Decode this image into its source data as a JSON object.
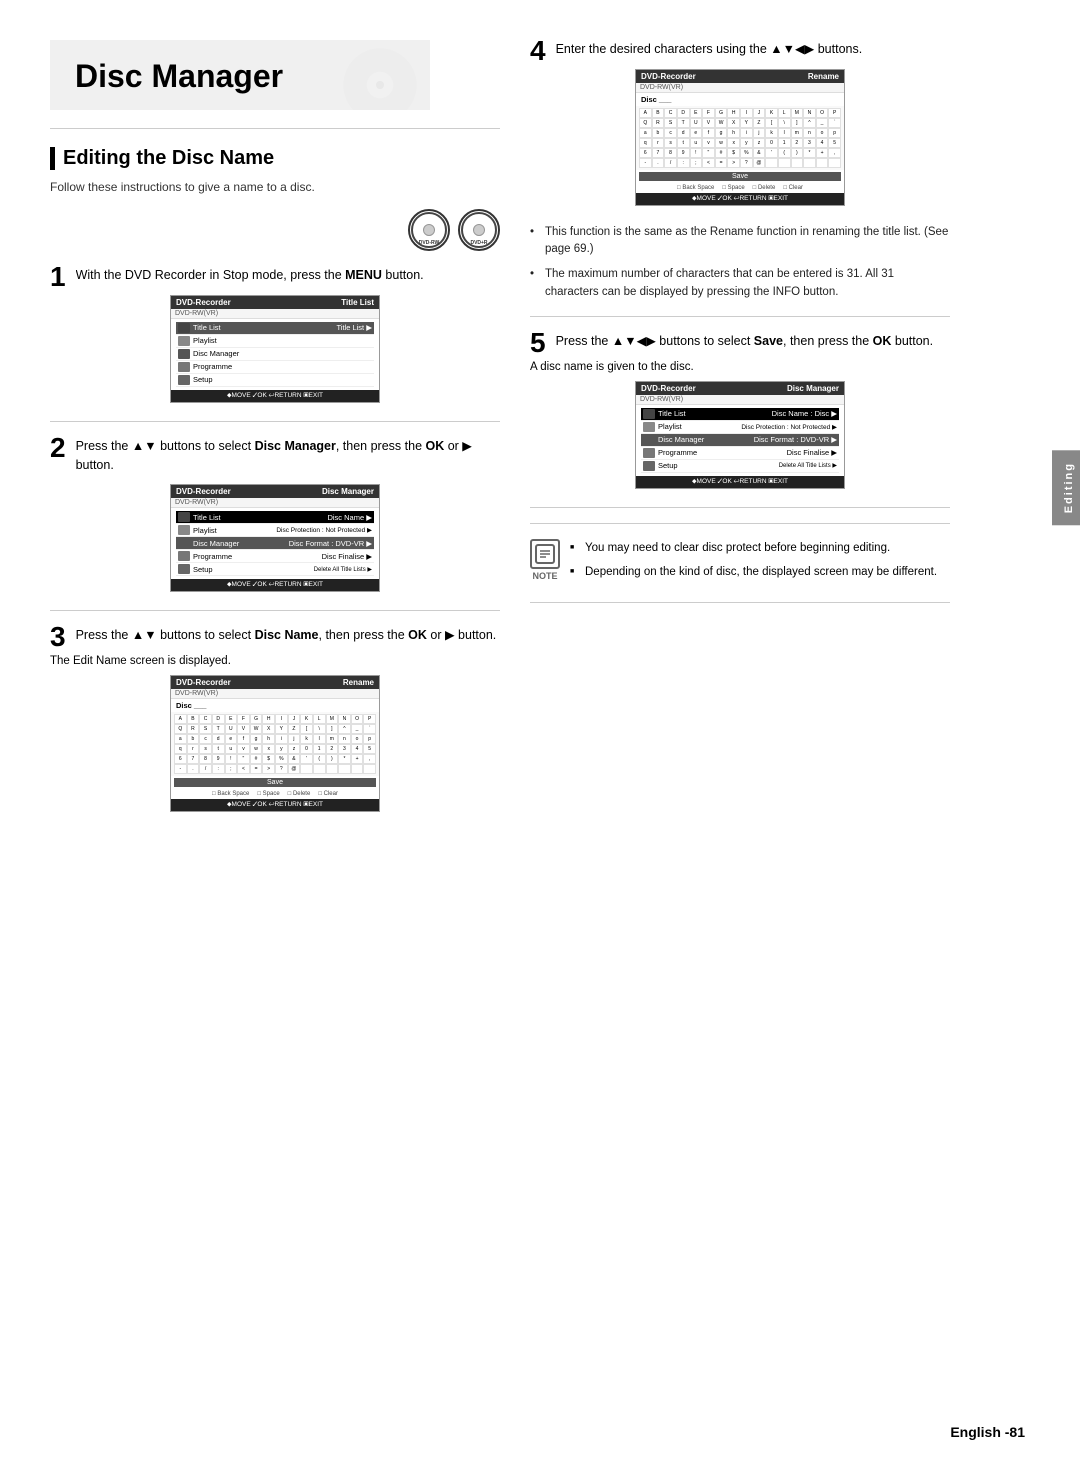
{
  "header": {
    "title": "Disc Manager",
    "section_title": "Editing the Disc Name",
    "follow_text": "Follow these instructions to give a name to a disc."
  },
  "dvd_icons": [
    {
      "label": "DVD-RW"
    },
    {
      "label": "DVD+R"
    }
  ],
  "steps": {
    "step1": {
      "number": "1",
      "text_main": "With the DVD Recorder in Stop mode, press the ",
      "text_bold": "MENU",
      "text_end": " button."
    },
    "step2": {
      "number": "2",
      "text_before": "Press the ▲▼ buttons to select ",
      "text_bold": "Disc Manager",
      "text_after": ", then press the ",
      "text_bold2": "OK",
      "text_end": " or ▶ button."
    },
    "step3": {
      "number": "3",
      "text_before": "Press the ▲▼ buttons to select ",
      "text_bold": "Disc Name",
      "text_after": ", then press the ",
      "text_bold2": "OK",
      "text_end": " or ▶ button.",
      "subtext": "The Edit Name screen is displayed."
    },
    "step4": {
      "number": "4",
      "text": "Enter the desired characters using the ▲▼◀▶ buttons."
    },
    "step5": {
      "number": "5",
      "text_before": "Press the ▲▼◀▶ buttons to select ",
      "text_bold": "Save",
      "text_after": ", then press the ",
      "text_bold2": "OK",
      "text_end": " button.",
      "subtext": "A disc name is given to the disc."
    }
  },
  "screen1": {
    "header_left": "DVD-Recorder",
    "header_right": "Title List",
    "dvd_label": "DVD-RW(VR)",
    "rows": [
      {
        "icon": "title-list",
        "label": "Title List",
        "value": "Title List",
        "active": true
      },
      {
        "icon": "playlist",
        "label": "Playlist",
        "value": ""
      },
      {
        "icon": "disc-manager",
        "label": "Disc Manager",
        "value": ""
      },
      {
        "icon": "programme",
        "label": "Programme",
        "value": ""
      },
      {
        "icon": "setup",
        "label": "Setup",
        "value": ""
      }
    ],
    "nav": "⬥MOVE  ✓OK  ↩RETURN  ▣EXIT"
  },
  "screen2": {
    "header_left": "DVD-Recorder",
    "header_right": "Disc Manager",
    "dvd_label": "DVD-RW(VR)",
    "rows": [
      {
        "icon": "title-list",
        "label": "Title List",
        "value": "Disc Name",
        "active": true
      },
      {
        "icon": "playlist",
        "label": "Playlist",
        "value": "Disc Protection : Not Protected"
      },
      {
        "icon": "disc-manager",
        "label": "Disc Manager",
        "value": "Disc Format  : DVD-VR"
      },
      {
        "icon": "programme",
        "label": "Programme",
        "value": "Disc Finalise"
      },
      {
        "icon": "setup",
        "label": "Setup",
        "value": "Delete All Title Lists"
      }
    ],
    "nav": "⬥MOVE  ✓OK  ↩RETURN  ▣EXIT"
  },
  "screen3_rename": {
    "header_left": "DVD-Recorder",
    "header_right": "Rename",
    "dvd_label": "DVD-RW(VR)",
    "disc_label": "Disc",
    "chars": [
      "A",
      "B",
      "C",
      "D",
      "E",
      "F",
      "G",
      "H",
      "I",
      "J",
      "K",
      "L",
      "M",
      "N",
      "O",
      "P",
      "Q",
      "R",
      "S",
      "T",
      "U",
      "V",
      "W",
      "X",
      "Y",
      "Z",
      "[",
      "\\",
      "]",
      "^",
      "_",
      "`",
      "a",
      "b",
      "c",
      "d",
      "e",
      "f",
      "g",
      "h",
      "i",
      "j",
      "k",
      "l",
      "m",
      "n",
      "o",
      "p",
      "q",
      "r",
      "s",
      "t",
      "u",
      "v",
      "w",
      "x",
      "y",
      "z",
      "0",
      "1",
      "2",
      "3",
      "4",
      "5",
      "6",
      "7",
      "8",
      "9",
      "!",
      "\"",
      "#",
      "$",
      "%",
      "&",
      "'",
      "(",
      ")",
      "*",
      "+",
      ",",
      "-",
      ".",
      "/",
      ":",
      ";",
      "<",
      "=",
      ">",
      "?",
      "@",
      "[",
      "\\",
      "]",
      "^",
      "_",
      " ",
      " ",
      " ",
      " ",
      " "
    ],
    "save_label": "Save",
    "options": [
      "Back Space",
      "Space",
      "Delete",
      "Clear"
    ],
    "nav": "⬥MOVE  ✓OK  ↩RETURN  ▣EXIT"
  },
  "screen4_rename": {
    "header_left": "DVD-Recorder",
    "header_right": "Rename",
    "dvd_label": "DVD-RW(VR)",
    "disc_label": "Disc",
    "save_label": "Save",
    "options": [
      "Back Space",
      "Space",
      "Delete",
      "Clear"
    ],
    "nav": "⬥MOVE  ✓OK  ↩RETURN  ▣EXIT"
  },
  "screen5": {
    "header_left": "DVD-Recorder",
    "header_right": "Disc Manager",
    "dvd_label": "DVD-RW(VR)",
    "rows": [
      {
        "label": "Title List",
        "value": "Disc Name : Disc",
        "active": true
      },
      {
        "label": "Playlist",
        "value": "Disc Protection : Not Protected"
      },
      {
        "label": "Disc Manager",
        "value": "Disc Format  : DVD-VR"
      },
      {
        "label": "Programme",
        "value": "Disc Finalise"
      },
      {
        "label": "Setup",
        "value": "Delete All Title Lists"
      }
    ],
    "nav": "⬥MOVE  ✓OK  ↩RETURN  ▣EXIT"
  },
  "bullets": {
    "bullet1": "This function is the same as the Rename function in renaming the title list. (See page 69.)",
    "bullet2": "The maximum number of characters that can be entered is 31. All 31 characters can be displayed by pressing the INFO button."
  },
  "notes": {
    "note1": "You may need to clear disc protect before beginning editing.",
    "note2": "Depending on the kind of disc, the displayed screen may be different."
  },
  "footer": {
    "text": "English -81"
  },
  "sidebar_tab": "Editing"
}
